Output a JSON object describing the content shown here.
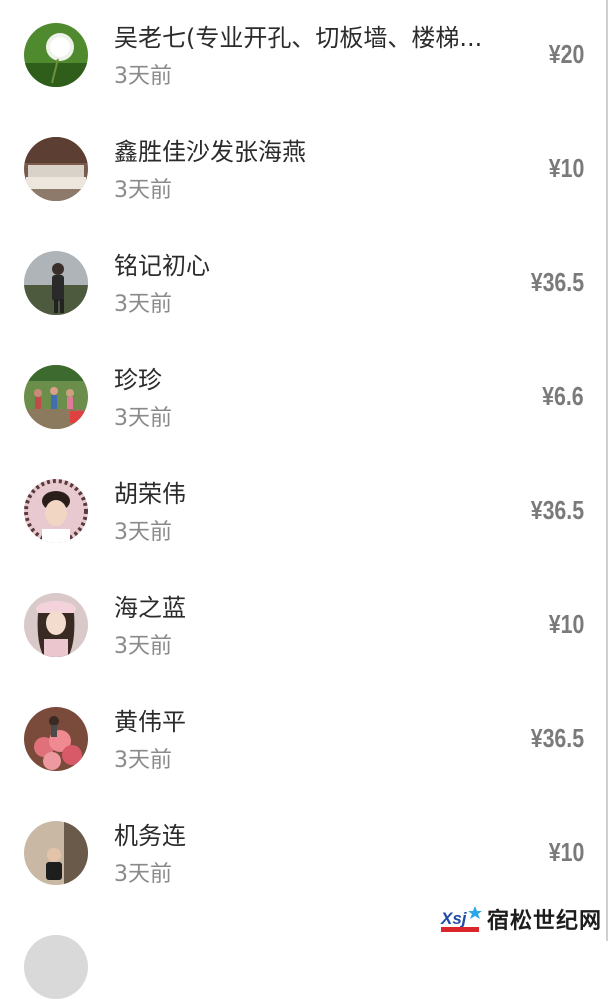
{
  "donors": [
    {
      "name": "吴老七(专业开孔、切板墙、楼梯...",
      "time": "3天前",
      "amount": "¥20",
      "avatar_icon": "dandelion-avatar-icon"
    },
    {
      "name": "鑫胜佳沙发张海燕",
      "time": "3天前",
      "amount": "¥10",
      "avatar_icon": "sofa-avatar-icon"
    },
    {
      "name": "铭记初心",
      "time": "3天前",
      "amount": "¥36.5",
      "avatar_icon": "person-outdoor-avatar-icon"
    },
    {
      "name": "珍珍",
      "time": "3天前",
      "amount": "¥6.6",
      "avatar_icon": "group-photo-avatar-icon"
    },
    {
      "name": "胡荣伟",
      "time": "3天前",
      "amount": "¥36.5",
      "avatar_icon": "portrait-avatar-icon"
    },
    {
      "name": "海之蓝",
      "time": "3天前",
      "amount": "¥10",
      "avatar_icon": "girl-hat-avatar-icon"
    },
    {
      "name": "黄伟平",
      "time": "3天前",
      "amount": "¥36.5",
      "avatar_icon": "flowers-avatar-icon"
    },
    {
      "name": "机务连",
      "time": "3天前",
      "amount": "¥10",
      "avatar_icon": "child-avatar-icon"
    }
  ],
  "watermark": {
    "text": "宿松世纪网"
  },
  "colors": {
    "name": "#2b2b2b",
    "time": "#8a8a8a",
    "amount": "#7a7a7a"
  }
}
